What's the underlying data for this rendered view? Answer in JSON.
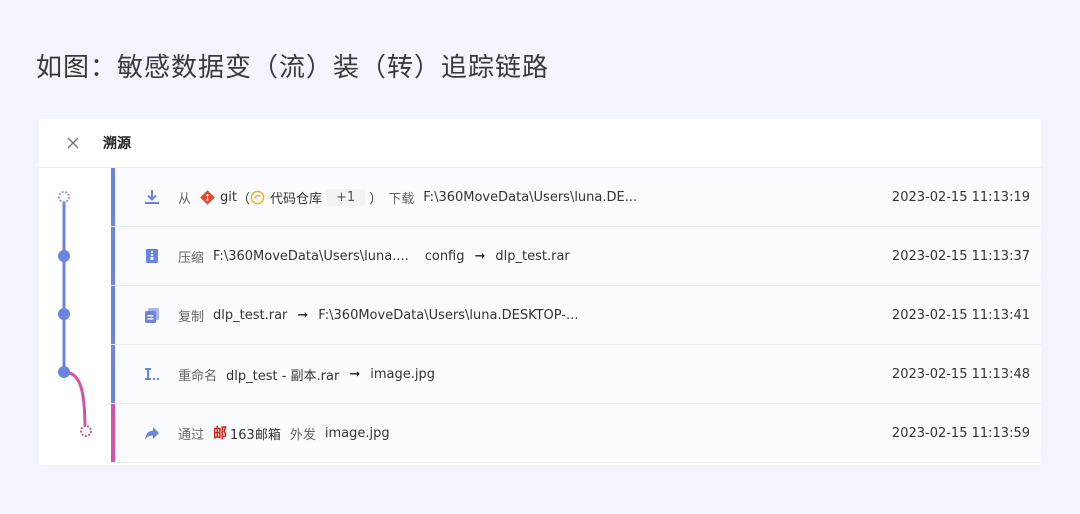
{
  "page": {
    "title": "如图：敏感数据变（流）装（转）追踪链路"
  },
  "panel": {
    "title": "溯源"
  },
  "colors": {
    "primary": "#6b84e0",
    "accent": "#d254a8",
    "git": "#e04b2c",
    "mail": "#d0261b"
  },
  "rows": [
    {
      "icon": "download-icon",
      "action": "从",
      "source_app": "git",
      "paren_open": "（",
      "repo": "代码仓库",
      "extra": "+1",
      "paren_close": "）",
      "verb": "下载",
      "path": "F:\\360MoveData\\Users\\luna.DE...",
      "time": "2023-02-15 11:13:19"
    },
    {
      "icon": "compress-icon",
      "action": "压缩",
      "from": "F:\\360MoveData\\Users\\luna....",
      "from2": "config",
      "arrow": "➞",
      "to": "dlp_test.rar",
      "time": "2023-02-15 11:13:37"
    },
    {
      "icon": "copy-icon",
      "action": "复制",
      "from": "dlp_test.rar",
      "arrow": "➞",
      "to": "F:\\360MoveData\\Users\\luna.DESKTOP-...",
      "time": "2023-02-15 11:13:41"
    },
    {
      "icon": "rename-icon",
      "action": "重命名",
      "from": "dlp_test - 副本.rar",
      "arrow": "➞",
      "to": "image.jpg",
      "time": "2023-02-15 11:13:48"
    },
    {
      "icon": "share-icon",
      "action": "通过",
      "mail_logo": "邮",
      "app": "163邮箱",
      "verb": "外发",
      "file": "image.jpg",
      "time": "2023-02-15 11:13:59"
    }
  ]
}
